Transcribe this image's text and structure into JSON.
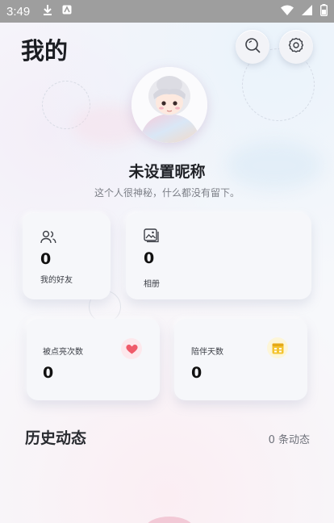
{
  "status_bar": {
    "time": "3:49"
  },
  "header": {
    "title": "我的"
  },
  "profile": {
    "nickname": "未设置昵称",
    "signature": "这个人很神秘，什么都没有留下。"
  },
  "stats": {
    "friends": {
      "value": "0",
      "label": "我的好友"
    },
    "album": {
      "value": "0",
      "label": "相册"
    },
    "lit": {
      "value": "0",
      "label": "被点亮次数"
    },
    "days": {
      "value": "0",
      "label": "陪伴天数"
    }
  },
  "history": {
    "title": "历史动态",
    "count": "0 条动态"
  },
  "colors": {
    "heart": "#ef5b6a",
    "calendar": "#f4c430",
    "accent_bg": "#fde8ec"
  },
  "icons": {
    "status": [
      "download-icon",
      "notification-icon",
      "wifi-icon",
      "signal-icon",
      "battery-icon"
    ],
    "header": [
      "search-icon",
      "gear-icon"
    ],
    "cards": [
      "people-icon",
      "album-icon",
      "heart-icon",
      "calendar-icon"
    ]
  }
}
